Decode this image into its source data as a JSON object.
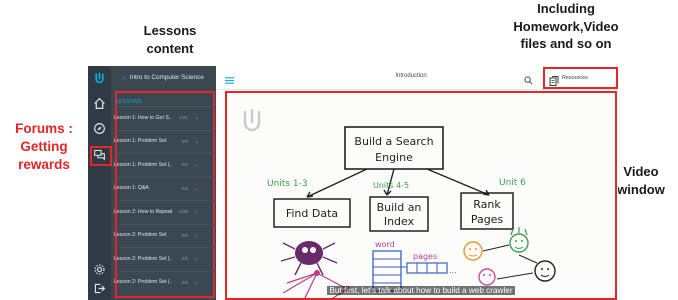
{
  "annotations": {
    "lessons": "Lessons\ncontent",
    "homework": "Including\nHomework,Video\nfiles and so on",
    "forums": "Forums :\nGetting\nrewards",
    "video": "Video\nwindow"
  },
  "sidebar_icons": [
    "udacity-logo-icon",
    "home-icon",
    "compass-icon",
    "forum-icon",
    "settings-icon",
    "logout-icon"
  ],
  "course": {
    "back_label": "Intro to Computer Science"
  },
  "lessons": {
    "title": "LESSONS",
    "items": [
      {
        "name": "Lesson 1: How to Get S...",
        "count": "1/41"
      },
      {
        "name": "Lesson 1: Problem Set",
        "count": "0/9"
      },
      {
        "name": "Lesson 1: Problem Set (...",
        "count": "0/4"
      },
      {
        "name": "Lesson 1: Q&A",
        "count": "0/6"
      },
      {
        "name": "Lesson 2: How to Repeat",
        "count": "0/38"
      },
      {
        "name": "Lesson 2: Problem Set",
        "count": "0/6"
      },
      {
        "name": "Lesson 2: Problem Set (...",
        "count": "0/5"
      },
      {
        "name": "Lesson 2: Problem Set (...",
        "count": "0/6"
      }
    ]
  },
  "topbar": {
    "title": "Introduction",
    "resources_label": "Resources"
  },
  "video": {
    "caption": "But first, let's talk about how to build a web crawler",
    "whiteboard": {
      "root": "Build a Search\nEngine",
      "nodes": [
        "Find Data",
        "Build an\nIndex",
        "Rank\nPages"
      ],
      "unit_labels": [
        "Units 1-3",
        "Units 4-5",
        "Unit 6"
      ],
      "sketch_labels": [
        "word",
        "pages"
      ]
    }
  },
  "colors": {
    "accent": "#02b3e4",
    "highlight": "#e32626",
    "sidebar_dark": "#2f3a44",
    "sidebar_panel": "#3b4751"
  }
}
